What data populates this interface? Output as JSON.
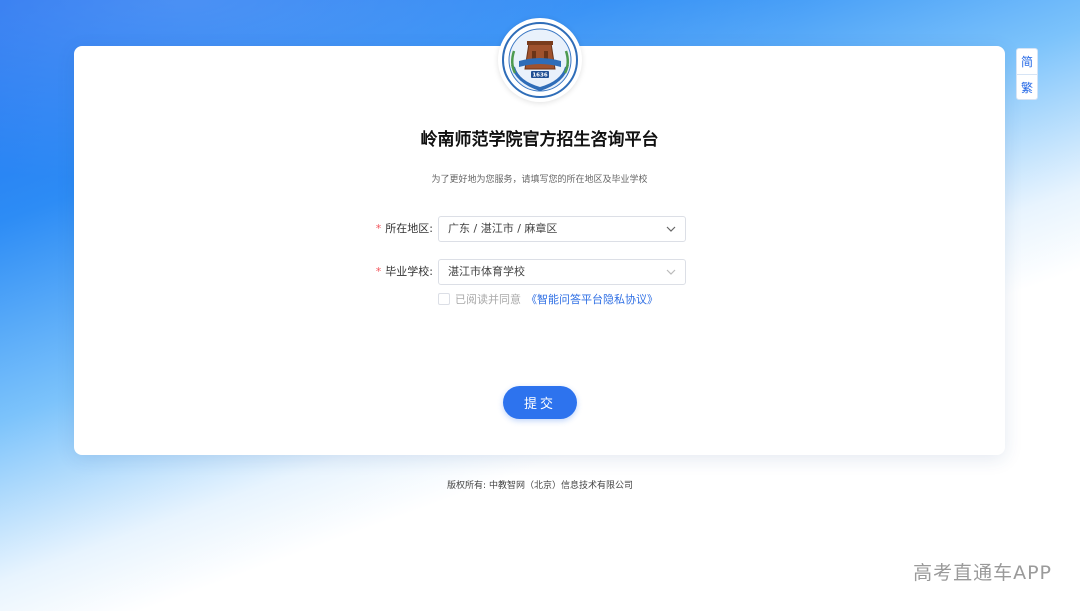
{
  "logo": {
    "name": "college-seal-icon",
    "year": "1636"
  },
  "lang": {
    "simplified": "简",
    "traditional": "繁"
  },
  "page": {
    "title": "岭南师范学院官方招生咨询平台",
    "subtitle": "为了更好地为您服务，请填写您的所在地区及毕业学校"
  },
  "form": {
    "region": {
      "required_mark": "*",
      "label": "所在地区:",
      "value": "广东 / 湛江市 / 麻章区"
    },
    "school": {
      "required_mark": "*",
      "label": "毕业学校:",
      "value": "湛江市体育学校"
    },
    "agreement": {
      "text": "已阅读并同意",
      "link": "《智能问答平台隐私协议》",
      "checked": false
    },
    "submit_label": "提交"
  },
  "footer": {
    "copyright": "版权所有: 中教智网（北京）信息技术有限公司"
  },
  "watermark": "高考直通车APP",
  "colors": {
    "primary": "#2d73ee",
    "required": "#f2545b",
    "link": "#2f6fe4"
  }
}
